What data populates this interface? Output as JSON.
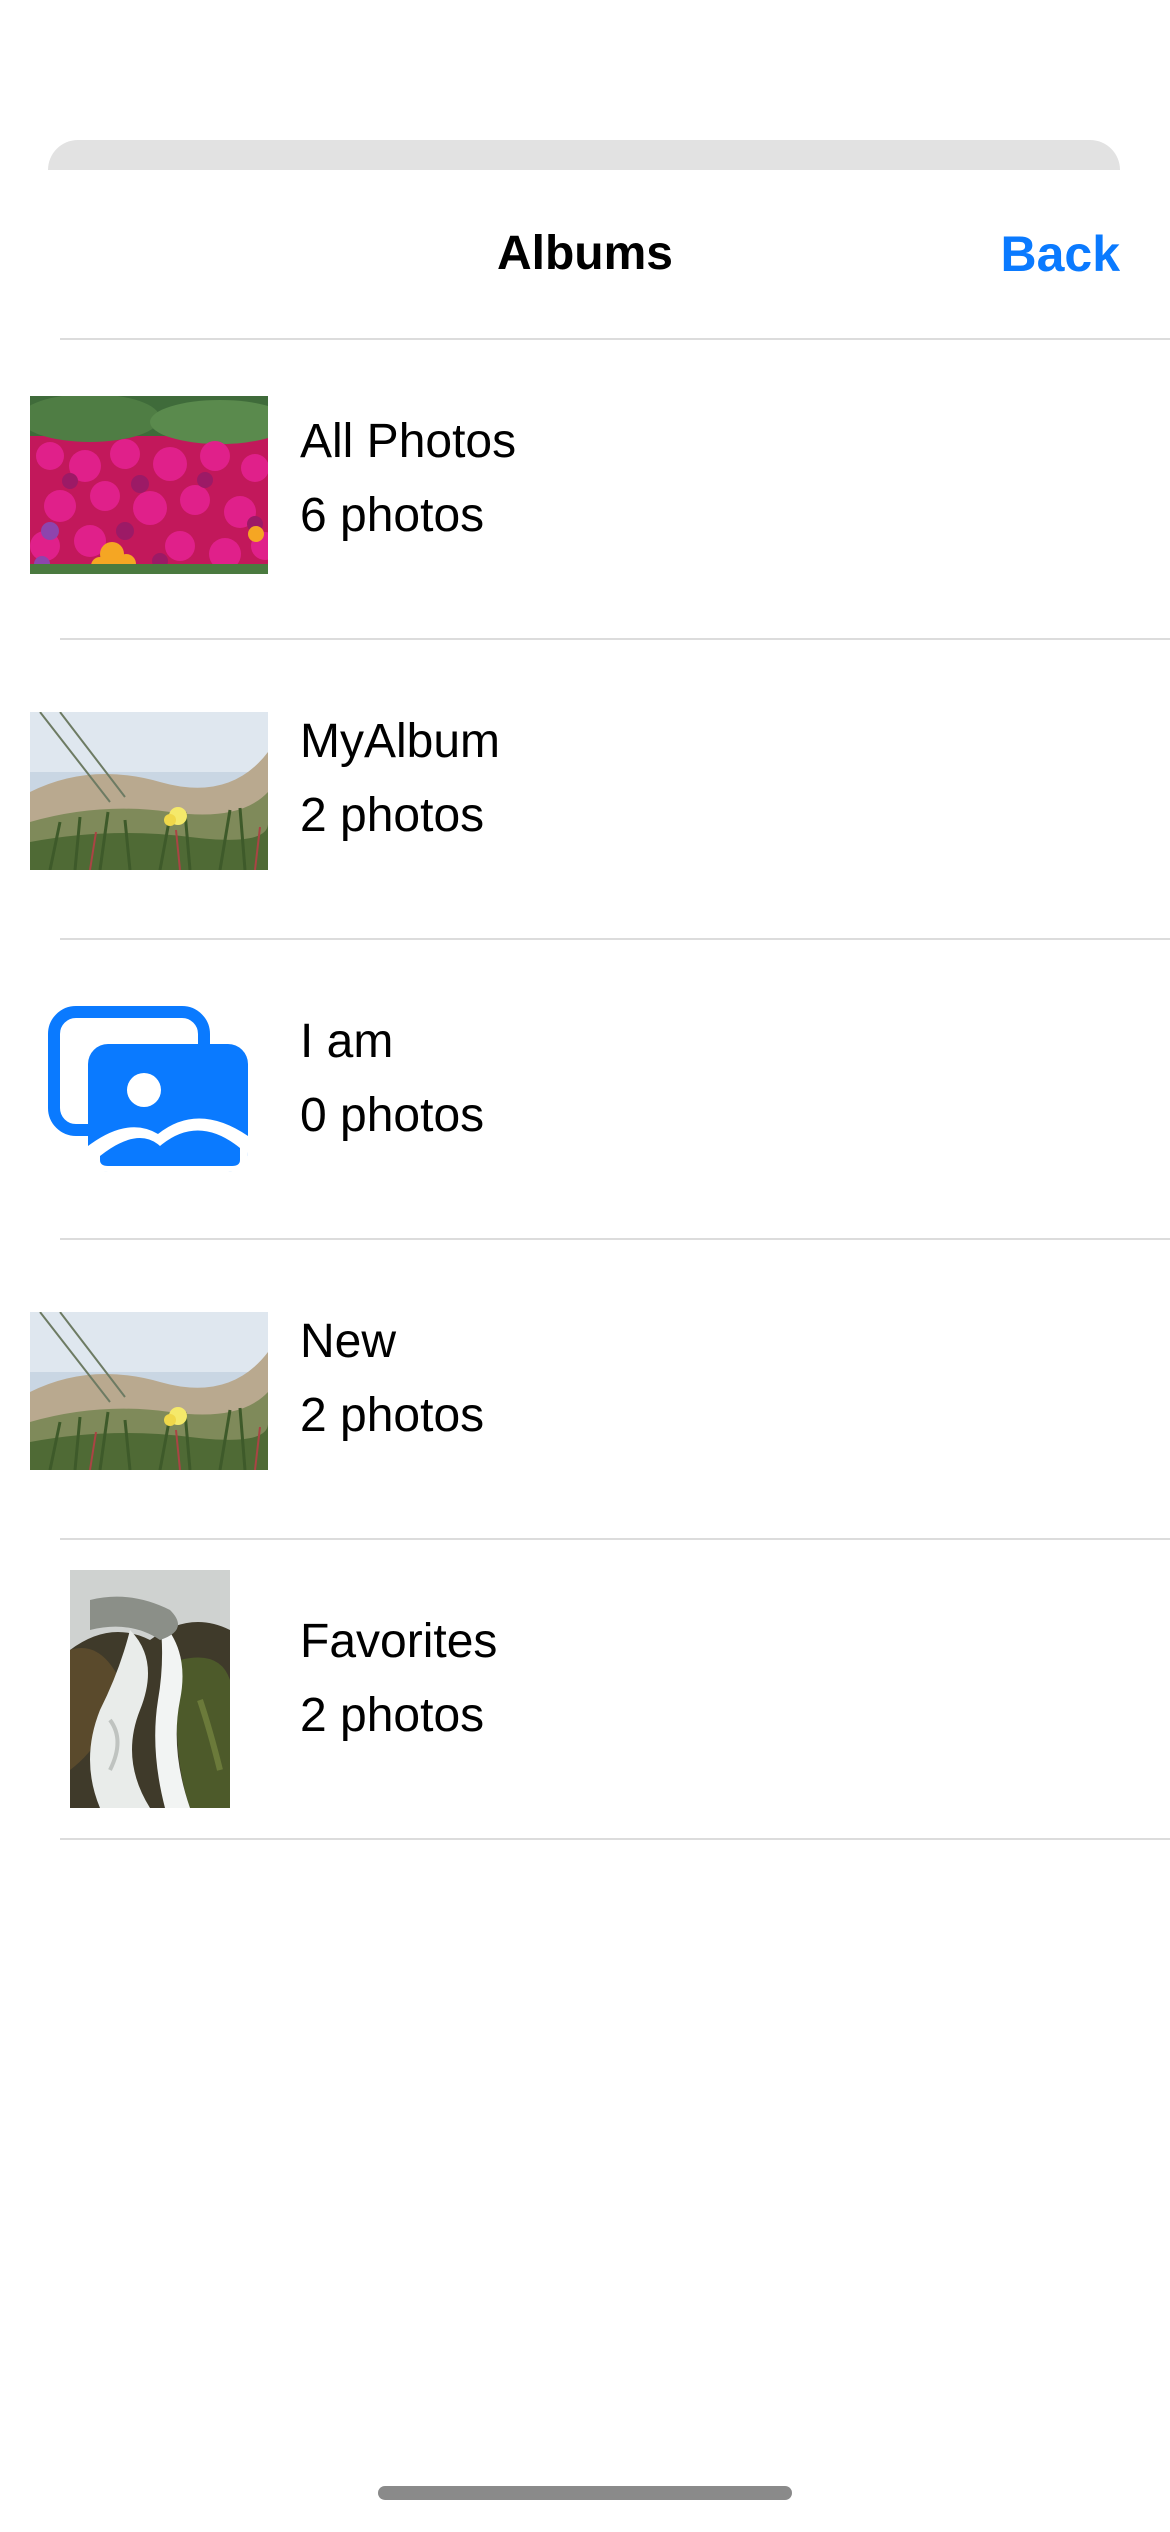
{
  "nav": {
    "title": "Albums",
    "back_label": "Back"
  },
  "albums": [
    {
      "name": "All Photos",
      "count": "6 photos",
      "thumbnail": "magenta-flower-field"
    },
    {
      "name": "MyAlbum",
      "count": "2 photos",
      "thumbnail": "dune-grass-yellow-flower"
    },
    {
      "name": "I am",
      "count": "0 photos",
      "thumbnail": "photo-stack-placeholder-icon"
    },
    {
      "name": "New",
      "count": "2 photos",
      "thumbnail": "dune-grass-yellow-flower"
    },
    {
      "name": "Favorites",
      "count": "2 photos",
      "thumbnail": "waterfall-rocks"
    }
  ],
  "colors": {
    "accent": "#0a7aff",
    "divider": "#dcdcdc",
    "sheet_edge": "#e2e2e2"
  }
}
